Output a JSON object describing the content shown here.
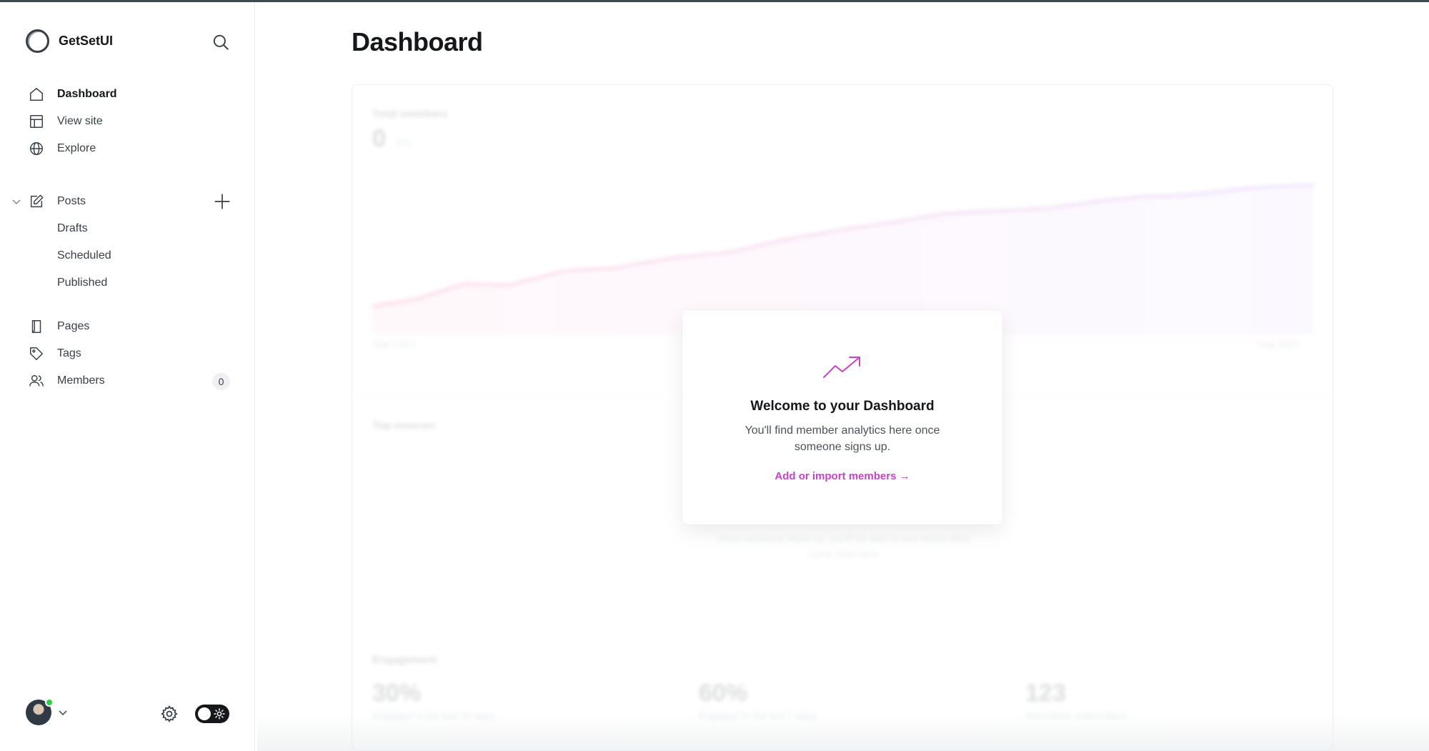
{
  "app": {
    "name": "GetSetUI"
  },
  "sidebar": {
    "search_icon": "search-icon",
    "nav": [
      {
        "label": "Dashboard",
        "icon": "home-icon",
        "active": true
      },
      {
        "label": "View site",
        "icon": "layout-icon"
      },
      {
        "label": "Explore",
        "icon": "globe-icon"
      }
    ],
    "posts": {
      "label": "Posts",
      "icon": "edit-icon",
      "expanded": true,
      "sub": [
        "Drafts",
        "Scheduled",
        "Published"
      ]
    },
    "sections": [
      {
        "label": "Pages",
        "icon": "page-icon"
      },
      {
        "label": "Tags",
        "icon": "tag-icon"
      },
      {
        "label": "Members",
        "icon": "members-icon",
        "count": "0"
      }
    ],
    "footer": {
      "online_color": "#30cf43",
      "theme_toggle": "dark"
    }
  },
  "main": {
    "title": "Dashboard",
    "background": {
      "total_members_label": "Total members",
      "total_members_value": "0",
      "total_members_delta": "0%",
      "chart_start_label": "Sep 2023",
      "chart_end_label": "Aug 2024",
      "top_sources_label": "Top sources",
      "top_sources_empty_1": "Once someone signs up, you'll be able to see where they",
      "top_sources_empty_2": "came from here",
      "engagement_label": "Engagement",
      "engagement": [
        {
          "value": "30%",
          "caption": "Engaged in the last 30 days"
        },
        {
          "value": "60%",
          "caption": "Engaged in the last 7 days"
        },
        {
          "value": "123",
          "caption": "Newsletter subscribers"
        }
      ]
    },
    "welcome": {
      "icon": "trending-up-icon",
      "title": "Welcome to your Dashboard",
      "text": "You'll find member analytics here once someone signs up.",
      "link": "Add or import members →",
      "accent": "#c443c6"
    }
  }
}
